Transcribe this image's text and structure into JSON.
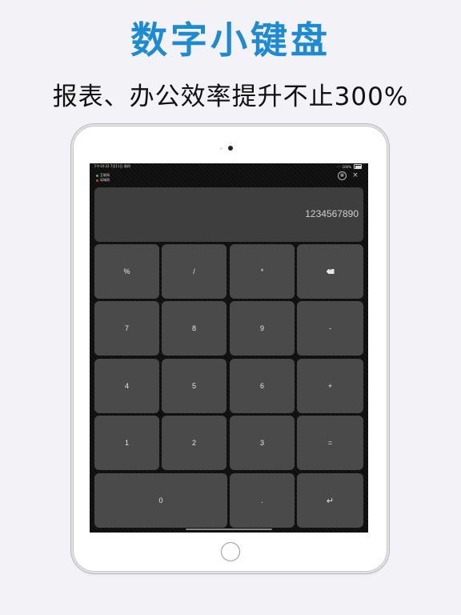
{
  "promo": {
    "headline": "数字小键盘",
    "subheadline": "报表、办公效率提升不止300%"
  },
  "status_bar": {
    "time": "下午10:32",
    "date": "7月11日 周四",
    "battery": "100%"
  },
  "connections": [
    {
      "label": "互联网",
      "color": "#2ecc40"
    },
    {
      "label": "局域网",
      "color": "#e53935"
    }
  ],
  "display": {
    "value": "1234567890"
  },
  "keys": {
    "percent": "%",
    "divide": "/",
    "multiply": "*",
    "seven": "7",
    "eight": "8",
    "nine": "9",
    "minus": "-",
    "four": "4",
    "five": "5",
    "six": "6",
    "plus": "+",
    "one": "1",
    "two": "2",
    "three": "3",
    "equals": "=",
    "zero": "0",
    "decimal": ".",
    "enter": "↵"
  },
  "icons": {
    "backspace": "backspace-icon",
    "calculator": "calculator-icon",
    "close": "close-icon",
    "enter": "enter-icon"
  },
  "colors": {
    "headline": "#1e8ad2",
    "key": "#4a4a4a",
    "display": "#3e3e3e"
  }
}
